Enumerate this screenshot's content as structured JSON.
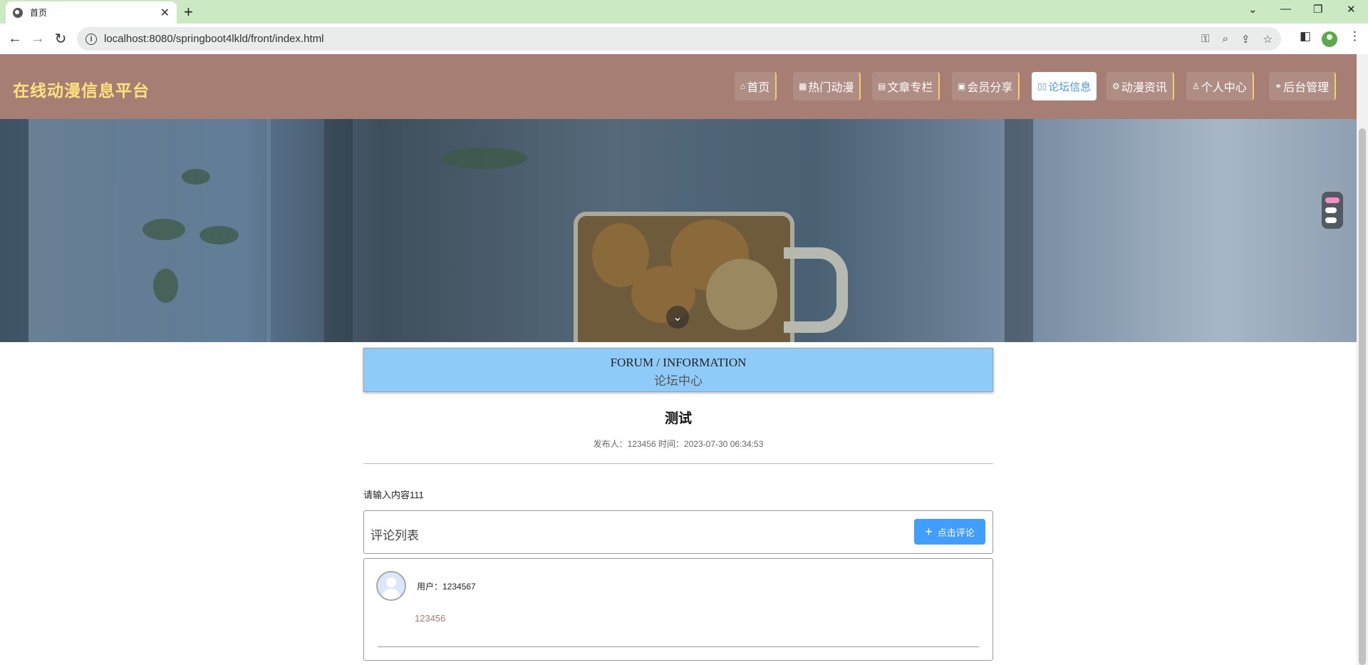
{
  "browser": {
    "tab_title": "首页",
    "tab_close": "✕",
    "new_tab": "+",
    "url": "localhost:8080/springboot4lkld/front/index.html"
  },
  "site": {
    "logo": "在线动漫信息平台",
    "nav": [
      {
        "label": "首页",
        "icon": "home-icon",
        "glyph": "⌂"
      },
      {
        "label": "热门动漫",
        "icon": "grid-icon",
        "glyph": "▦"
      },
      {
        "label": "文章专栏",
        "icon": "document-icon",
        "glyph": "▤"
      },
      {
        "label": "会员分享",
        "icon": "gift-icon",
        "glyph": "▣"
      },
      {
        "label": "论坛信息",
        "icon": "chat-icon",
        "glyph": "▯▯"
      },
      {
        "label": "动漫资讯",
        "icon": "gear-icon",
        "glyph": "⚙"
      },
      {
        "label": "个人中心",
        "icon": "user-icon",
        "glyph": "♙"
      },
      {
        "label": "后台管理",
        "icon": "link-icon",
        "glyph": "⚭"
      }
    ],
    "active_nav": "论坛信息"
  },
  "section": {
    "title_en": "FORUM / INFORMATION",
    "title_cn": "论坛中心"
  },
  "post": {
    "title": "测试",
    "meta": "发布人：123456 时间：2023-07-30 06:34:53",
    "body": "请输入内容111"
  },
  "comments": {
    "header": "评论列表",
    "button_label": "点击评论",
    "items": [
      {
        "user": "用户：1234567",
        "text": "123456"
      }
    ]
  },
  "colors": {
    "header_bg": "#a67e74",
    "logo": "#ffe27e",
    "section_bg": "#8fcbf8",
    "accent": "#409eff"
  }
}
